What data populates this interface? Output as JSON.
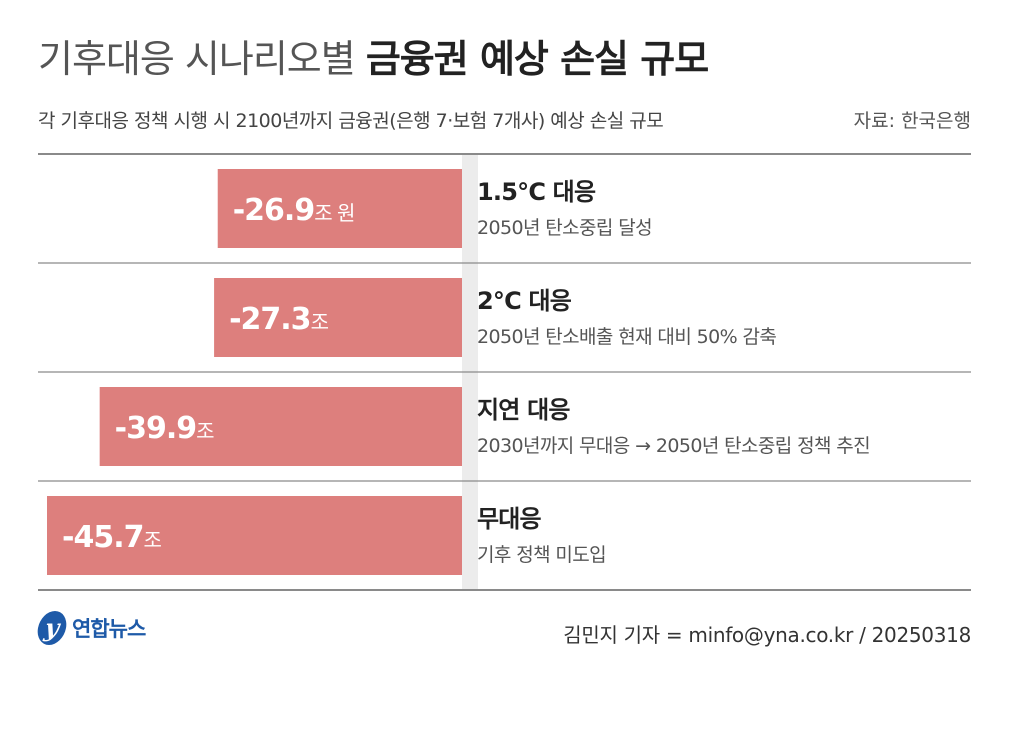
{
  "title": {
    "light": "기후대응 시나리오별",
    "bold": "금융권 예상 손실 규모"
  },
  "subtitle": "각 기후대응 정책 시행 시 2100년까지 금융권(은행 7·보험 7개사) 예상 손실 규모",
  "source": "자료: 한국은행",
  "chart_data": {
    "type": "bar",
    "orientation": "horizontal",
    "direction": "leftward",
    "unit": "조 원",
    "categories": [
      "1.5°C 대응",
      "2°C 대응",
      "지연 대응",
      "무대응"
    ],
    "descriptions": [
      "2050년 탄소중립 달성",
      "2050년 탄소배출 현재 대비 50% 감축",
      "2030년까지 무대응 → 2050년 탄소중립 정책 추진",
      "기후 정책 미도입"
    ],
    "values": [
      -26.9,
      -27.3,
      -39.9,
      -45.7
    ],
    "value_labels": [
      "-26.9",
      "-27.3",
      "-39.9",
      "-45.7"
    ],
    "unit_labels": [
      "조 원",
      "조",
      "조",
      "조"
    ],
    "bar_color": "#dd7f7d",
    "grid": false
  },
  "footer": {
    "credit": "김민지 기자 = minfo@yna.co.kr / 20250318",
    "logo_text": "연합뉴스"
  },
  "colors": {
    "bar": "#dd7f7d",
    "row_shade": "#ececec",
    "rule": "#8a8a8a",
    "logo": "#1e5aa8"
  }
}
